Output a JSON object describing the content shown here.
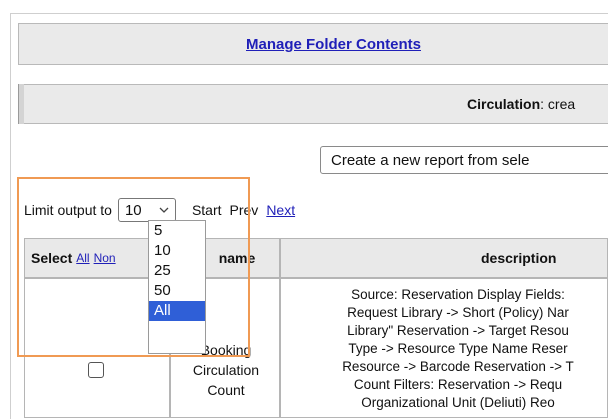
{
  "manage": {
    "link_label": "Manage Folder Contents"
  },
  "circulation": {
    "label": "Circulation",
    "suffix": ": crea"
  },
  "report_select": {
    "value": "Create a new report from sele"
  },
  "limit": {
    "label": "Limit output to",
    "value": "10",
    "start": "Start",
    "prev": "Prev",
    "next": "Next",
    "options": [
      "5",
      "10",
      "25",
      "50",
      "All"
    ],
    "highlighted_option": "All"
  },
  "table": {
    "headers": {
      "select": "Select",
      "select_all": "All",
      "select_none": "Non",
      "name": "name",
      "description": "description"
    },
    "row": {
      "name_lines": [
        "Booking",
        "Circulation",
        "Count"
      ],
      "description_lines": [
        "Source: Reservation Display Fields:",
        "Request Library -> Short (Policy) Nar",
        "Library\" Reservation -> Target Resou",
        "Type -> Resource Type Name Reser",
        "Resource -> Barcode Reservation -> T",
        "Count Filters: Reservation -> Requ",
        "Organizational Unit (Deliuti) Reo"
      ]
    }
  },
  "colors": {
    "link": "#1f1fb8",
    "highlight_border": "#f09a53",
    "selected_option": "#2f5fd7"
  }
}
